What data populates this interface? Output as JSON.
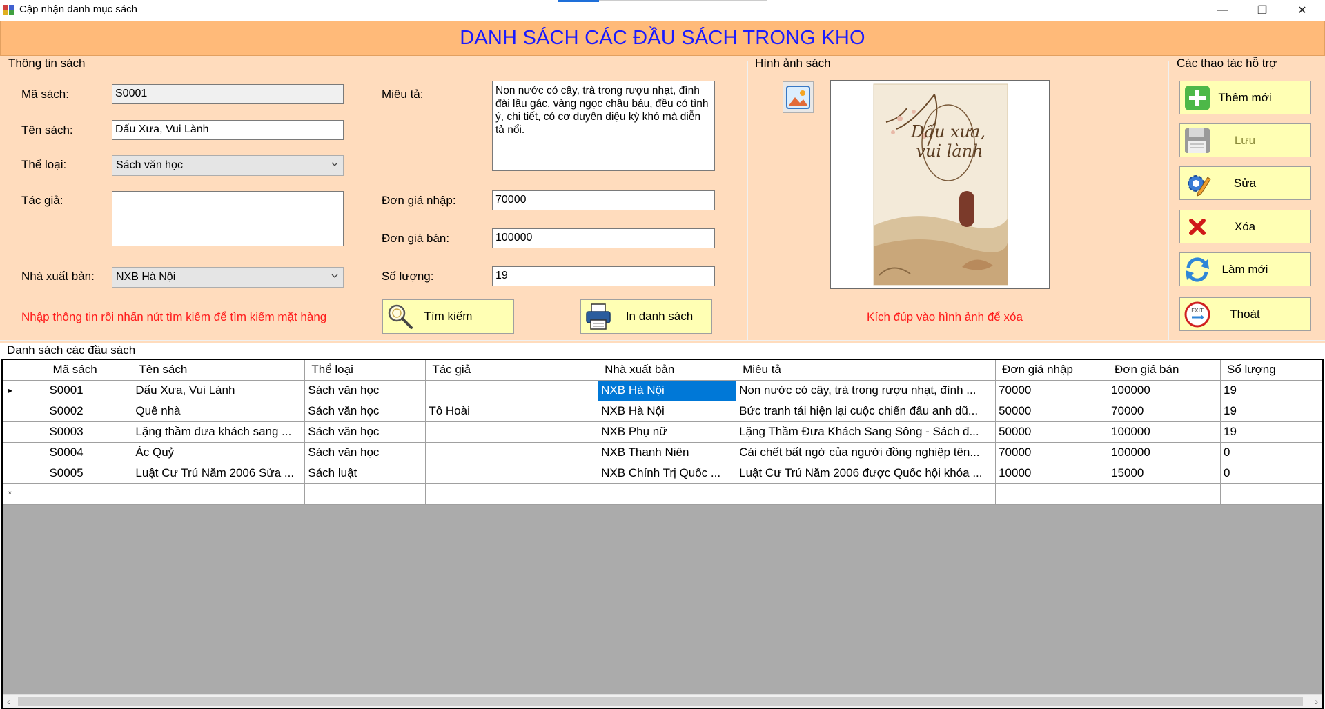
{
  "window": {
    "title": "Cập nhận danh mục sách",
    "minimize_glyph": "—",
    "restore_glyph": "❐",
    "close_glyph": "✕"
  },
  "header": {
    "title": "DANH SÁCH CÁC ĐẦU SÁCH TRONG KHO"
  },
  "book_info": {
    "group_title": "Thông tin sách",
    "code_label": "Mã sách:",
    "code_value": "S0001",
    "name_label": "Tên sách:",
    "name_value": "Dấu Xưa, Vui Lành",
    "genre_label": "Thể loại:",
    "genre_value": "Sách văn học",
    "author_label": "Tác giả:",
    "author_value": "",
    "publisher_label": "Nhà xuất bản:",
    "publisher_value": "NXB Hà Nội",
    "description_label": "Miêu tả:",
    "description_value": "Non nước có cây, trà trong rượu nhạt, đình đài lầu gác, vàng ngọc châu báu, đều có tình ý, chi tiết, có cơ duyên diệu kỳ khó mà diễn tả nổi.",
    "import_price_label": "Đơn giá nhập:",
    "import_price_value": "70000",
    "sale_price_label": "Đơn giá bán:",
    "sale_price_value": "100000",
    "quantity_label": "Số lượng:",
    "quantity_value": "19",
    "hint": "Nhập thông tin rồi nhấn nút tìm kiếm để tìm kiếm mặt hàng",
    "search_button": "Tìm kiếm",
    "print_button": "In danh sách"
  },
  "image_panel": {
    "group_title": "Hình ảnh sách",
    "hint": "Kích đúp vào hình ảnh để xóa",
    "cover_title_line1": "Dấu xưa,",
    "cover_title_line2": "vui lành"
  },
  "actions": {
    "group_title": "Các thao tác hỗ trợ",
    "add": "Thêm mới",
    "save": "Lưu",
    "edit": "Sửa",
    "delete": "Xóa",
    "refresh": "Làm mới",
    "exit": "Thoát"
  },
  "list": {
    "section_title": "Danh sách các đầu sách",
    "columns": [
      "Mã sách",
      "Tên sách",
      "Thể loại",
      "Tác giả",
      "Nhà xuất bản",
      "Miêu tả",
      "Đơn giá nhập",
      "Đơn giá bán",
      "Số lượng"
    ],
    "current_row_marker": "▸",
    "new_row_marker": "*",
    "rows": [
      [
        "S0001",
        "Dấu Xưa, Vui Lành",
        "Sách văn học",
        "",
        "NXB Hà Nội",
        "Non nước có cây, trà trong rượu nhạt, đình ...",
        "70000",
        "100000",
        "19"
      ],
      [
        "S0002",
        "Quê nhà",
        "Sách văn học",
        "Tô Hoài",
        "NXB Hà Nội",
        "Bức tranh tái hiện lại cuộc chiến đấu anh dũ...",
        "50000",
        "70000",
        "19"
      ],
      [
        "S0003",
        "Lặng thầm đưa khách sang ...",
        "Sách văn học",
        "",
        "NXB Phụ nữ",
        "Lặng Thầm Đưa Khách Sang Sông - Sách đ...",
        "50000",
        "100000",
        "19"
      ],
      [
        "S0004",
        "Ác Quỷ",
        "Sách văn học",
        "",
        "NXB Thanh Niên",
        "Cái chết bất ngờ của người đồng nghiệp tên...",
        "70000",
        "100000",
        "0"
      ],
      [
        "S0005",
        "Luật Cư Trú Năm 2006 Sửa ...",
        "Sách luật",
        "",
        "NXB Chính Trị Quốc ...",
        "Luật Cư Trú Năm 2006 được Quốc hội khóa ...",
        "10000",
        "15000",
        "0"
      ]
    ]
  },
  "colors": {
    "header_bg": "#ffba79",
    "form_bg": "#ffdcbd",
    "title_blue": "#1a1aff",
    "button_bg": "#ffffb4",
    "hint_red": "#ff1a1a",
    "selection": "#0078d7"
  }
}
